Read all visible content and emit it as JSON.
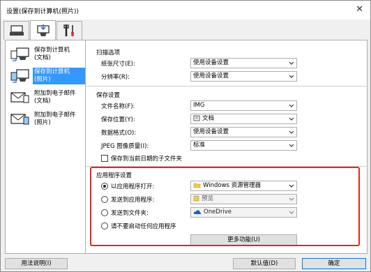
{
  "window": {
    "title": "设置(保存到计算机(照片))",
    "close": "✕"
  },
  "tabs": [
    {
      "name": "scan-tab"
    },
    {
      "name": "save-tab"
    },
    {
      "name": "tools-tab"
    }
  ],
  "nav": [
    {
      "label": "保存到计算机\n(文档)"
    },
    {
      "label": "保存到计算机\n(照片)",
      "selected": true
    },
    {
      "label": "附加到电子邮件\n(文档)"
    },
    {
      "label": "附加到电子邮件\n(照片)"
    }
  ],
  "scan_options": {
    "title": "扫描选项",
    "paper_size_label": "纸张尺寸(E):",
    "paper_size_value": "使用设备设置",
    "resolution_label": "分辨率(R):",
    "resolution_value": "使用设备设置"
  },
  "save_settings": {
    "title": "保存设置",
    "filename_label": "文件名称(F):",
    "filename_value": "IMG",
    "location_label": "保存位置(Y):",
    "location_value": "文档",
    "format_label": "数据格式(O):",
    "format_value": "使用设备设置",
    "jpeg_label": "JPEG 图像质量(I):",
    "jpeg_value": "标准",
    "subfolder_label": "保存到当前日期的子文件夹"
  },
  "app_settings": {
    "title": "应用程序设置",
    "open_label": "以应用程序打开:",
    "open_value": "Windows 资源管理器",
    "send_app_label": "发送到应用程序:",
    "send_app_value": "预览",
    "send_folder_label": "发送到文件夹:",
    "send_folder_value": "OneDrive",
    "none_label": "请不要启动任何应用程序",
    "more_button": "更多功能(U)"
  },
  "bottom": {
    "help": "用法说明(I)",
    "defaults": "默认值(D)",
    "ok": "确定"
  }
}
